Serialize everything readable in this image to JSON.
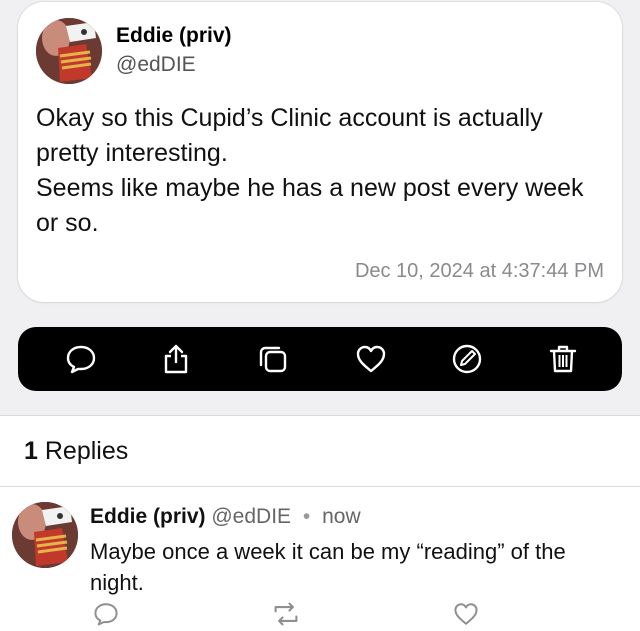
{
  "post": {
    "author_name": "Eddie (priv)",
    "author_handle": "@edDIE",
    "body_lines": [
      "Okay so this Cupid’s Clinic account is actually pretty interesting.",
      "Seems like maybe he has a new post every week or so."
    ],
    "timestamp": "Dec 10, 2024 at 4:37:44 PM"
  },
  "action_bar": {
    "icons": [
      "reply-icon",
      "share-icon",
      "copy-icon",
      "heart-icon",
      "edit-icon",
      "trash-icon"
    ]
  },
  "replies": {
    "count": "1",
    "label": "Replies",
    "items": [
      {
        "author_name": "Eddie (priv)",
        "author_handle": "@edDIE",
        "separator": "•",
        "time": "now",
        "body": "Maybe once a week it can be my “reading” of the night.",
        "icons": [
          "reply-icon",
          "repost-icon",
          "like-icon"
        ]
      }
    ]
  },
  "colors": {
    "background_top": "#f0f0f2",
    "card": "#ffffff",
    "action_bar": "#000000",
    "secondary_text": "#8a8a8e"
  }
}
